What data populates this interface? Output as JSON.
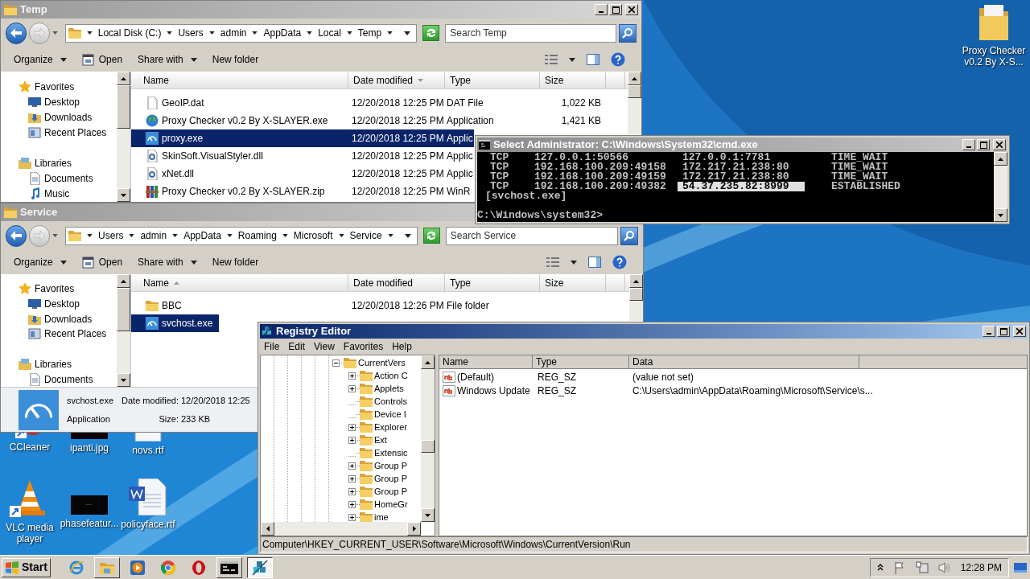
{
  "temp_explorer": {
    "title": "Temp",
    "breadcrumbs": [
      "Local Disk (C:)",
      "Users",
      "admin",
      "AppData",
      "Local",
      "Temp"
    ],
    "search": {
      "placeholder": "Search Temp"
    },
    "toolbar": [
      {
        "label": "Organize",
        "kind": "menu"
      },
      {
        "label": "Open",
        "kind": "open"
      },
      {
        "label": "Share with",
        "kind": "menu"
      },
      {
        "label": "New folder",
        "kind": "plain"
      }
    ],
    "sidebar": [
      {
        "label": "Favorites",
        "kind": "favorites"
      },
      {
        "label": "Desktop",
        "kind": "desktop"
      },
      {
        "label": "Downloads",
        "kind": "downloads"
      },
      {
        "label": "Recent Places",
        "kind": "recent"
      },
      {
        "label": "Libraries",
        "kind": "libraries"
      },
      {
        "label": "Documents",
        "kind": "documents"
      },
      {
        "label": "Music",
        "kind": "music"
      }
    ],
    "columns": [
      {
        "label": "Name",
        "sorted": false
      },
      {
        "label": "Date modified",
        "sorted": true,
        "descending": true
      },
      {
        "label": "Type",
        "sorted": false
      },
      {
        "label": "Size",
        "sorted": false
      }
    ],
    "files": [
      {
        "name": "GeoIP.dat",
        "kind": "data",
        "date": "12/20/2018 12:25 PM",
        "type": "DAT File",
        "size": "1,022 KB",
        "selected": false
      },
      {
        "name": "Proxy Checker v0.2 By X-SLAYER.exe",
        "kind": "globe",
        "date": "12/20/2018 12:25 PM",
        "type": "Application",
        "size": "1,421 KB",
        "selected": false
      },
      {
        "name": "proxy.exe",
        "kind": "app",
        "date": "12/20/2018 12:25 PM",
        "type": "Applic",
        "selected": true
      },
      {
        "name": "SkinSoft.VisualStyler.dll",
        "kind": "dll",
        "date": "12/20/2018 12:25 PM",
        "type": "Applic",
        "selected": false
      },
      {
        "name": "xNet.dll",
        "kind": "dll",
        "date": "12/20/2018 12:25 PM",
        "type": "Applic",
        "selected": false
      },
      {
        "name": "Proxy Checker v0.2 By X-SLAYER.zip",
        "kind": "archive",
        "date": "12/20/2018 12:25 PM",
        "type": "WinR",
        "selected": false
      }
    ]
  },
  "console": {
    "title": "Select Administrator: C:\\Windows\\System32\\cmd.exe",
    "connections": [
      {
        "proto": "TCP",
        "local": "127.0.0.1:50566",
        "foreign": "127.0.0.1:7781",
        "state": "TIME_WAIT",
        "selected": false
      },
      {
        "proto": "TCP",
        "local": "192.168.100.209:49158",
        "foreign": "172.217.21.238:80",
        "state": "TIME_WAIT",
        "selected": false
      },
      {
        "proto": "TCP",
        "local": "192.168.100.209:49159",
        "foreign": "172.217.21.238:80",
        "state": "TIME_WAIT",
        "selected": false
      },
      {
        "proto": "TCP",
        "local": "192.168.100.209:49382",
        "foreign": "54.37.235.82:8999",
        "state": "ESTABLISHED",
        "selected": true
      }
    ],
    "owner": "[svchost.exe]",
    "prompt": "C:\\Windows\\system32>"
  },
  "service_explorer": {
    "title": "Service",
    "breadcrumbs": [
      "Users",
      "admin",
      "AppData",
      "Roaming",
      "Microsoft",
      "Service"
    ],
    "search": {
      "placeholder": "Search Service"
    },
    "toolbar": [
      {
        "label": "Organize",
        "kind": "menu"
      },
      {
        "label": "Open",
        "kind": "open"
      },
      {
        "label": "Share with",
        "kind": "menu"
      },
      {
        "label": "New folder",
        "kind": "plain"
      }
    ],
    "sidebar": [
      {
        "label": "Favorites",
        "kind": "favorites"
      },
      {
        "label": "Desktop",
        "kind": "desktop"
      },
      {
        "label": "Downloads",
        "kind": "downloads"
      },
      {
        "label": "Recent Places",
        "kind": "recent"
      },
      {
        "label": "Libraries",
        "kind": "libraries"
      },
      {
        "label": "Documents",
        "kind": "documents"
      }
    ],
    "columns": [
      {
        "label": "Name",
        "sorted": true,
        "descending": false
      },
      {
        "label": "Date modified",
        "sorted": false
      },
      {
        "label": "Type",
        "sorted": false
      },
      {
        "label": "Size",
        "sorted": false
      }
    ],
    "files": [
      {
        "name": "BBC",
        "kind": "folder",
        "date": "12/20/2018 12:26 PM",
        "type": "File folder",
        "selected": false
      },
      {
        "name": "svchost.exe",
        "kind": "app",
        "selected": true
      }
    ],
    "details": {
      "name": "svchost.exe",
      "date_label": "Date modified:",
      "date": "12/20/2018 12:25",
      "type": "Application",
      "size_label": "Size:",
      "size": "233 KB"
    }
  },
  "registry_editor": {
    "title": "Registry Editor",
    "menu": [
      "File",
      "Edit",
      "View",
      "Favorites",
      "Help"
    ],
    "tree": [
      {
        "label": "CurrentVers",
        "expanded": true,
        "children": [
          {
            "label": "Action C",
            "expandable": true
          },
          {
            "label": "Applets",
            "expandable": true
          },
          {
            "label": "Controls",
            "expandable": false
          },
          {
            "label": "Device I",
            "expandable": false
          },
          {
            "label": "Explorer",
            "expandable": true
          },
          {
            "label": "Ext",
            "expandable": true
          },
          {
            "label": "Extensic",
            "expandable": false
          },
          {
            "label": "Group P",
            "expandable": true
          },
          {
            "label": "Group P",
            "expandable": true
          },
          {
            "label": "Group P",
            "expandable": true
          },
          {
            "label": "HomeGr",
            "expandable": true
          },
          {
            "label": "ime",
            "expandable": true
          }
        ]
      }
    ],
    "columns": [
      "Name",
      "Type",
      "Data"
    ],
    "values": [
      {
        "name": "(Default)",
        "type": "REG_SZ",
        "data": "(value not set)"
      },
      {
        "name": "Windows Update",
        "type": "REG_SZ",
        "data": "C:\\Users\\admin\\AppData\\Roaming\\Microsoft\\Service\\s..."
      }
    ],
    "status": "Computer\\HKEY_CURRENT_USER\\Software\\Microsoft\\Windows\\CurrentVersion\\Run"
  },
  "desktop": {
    "icons": [
      {
        "label": "Proxy Checker v0.2 By X-S...",
        "kind": "folder"
      },
      {
        "label": "CCleaner",
        "kind": "ccleaner"
      },
      {
        "label": "ipanti.jpg",
        "kind": "dark-image"
      },
      {
        "label": "novs.rtf",
        "kind": "document"
      },
      {
        "label": "VLC media player",
        "kind": "vlc"
      },
      {
        "label": "phasefeatur...",
        "kind": "dark-image"
      },
      {
        "label": "policyface.rtf",
        "kind": "word"
      }
    ]
  },
  "taskbar": {
    "start": "Start",
    "apps": [
      {
        "kind": "ie",
        "open": false,
        "selected": false
      },
      {
        "kind": "explorer",
        "open": true,
        "selected": false
      },
      {
        "kind": "media",
        "open": false,
        "selected": false
      },
      {
        "kind": "chrome",
        "open": false,
        "selected": false
      },
      {
        "kind": "opera",
        "open": false,
        "selected": false
      },
      {
        "kind": "cmd",
        "open": true,
        "selected": false
      },
      {
        "kind": "regedit",
        "open": true,
        "selected": true
      }
    ],
    "clock": "12:28 PM"
  }
}
